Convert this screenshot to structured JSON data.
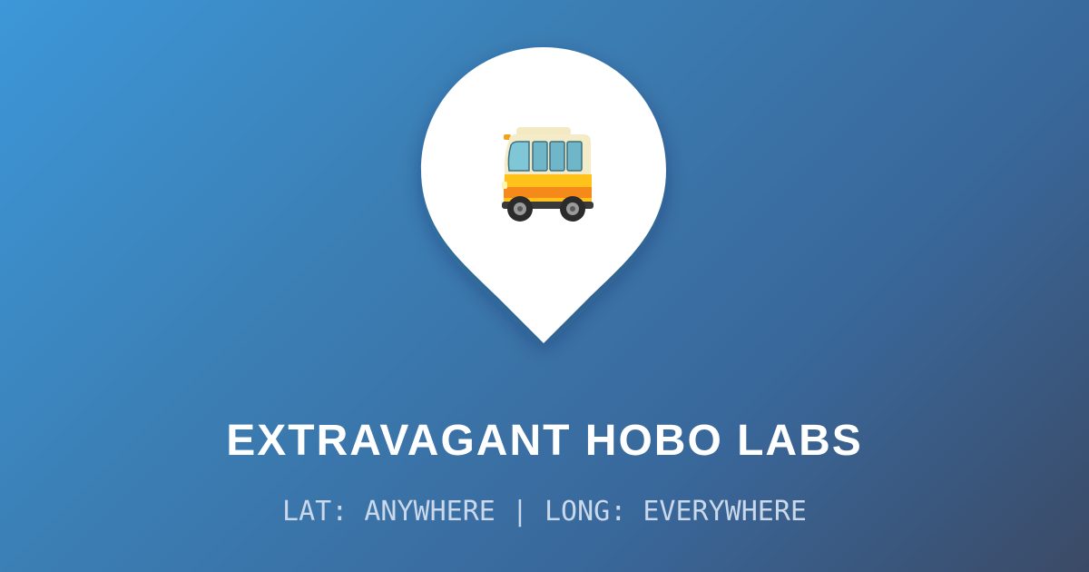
{
  "page": {
    "title": "EXTRAVAGANT HOBO LABS",
    "subtitle": "LAT: ANYWHERE | LONG: EVERYWHERE"
  },
  "pin": {
    "icon": "bus-icon",
    "fill": "#ffffff"
  },
  "colors": {
    "gradient_start": "#3d97d8",
    "gradient_end": "#3b4a66",
    "title": "#ffffff",
    "subtitle": "#c9d8ea"
  }
}
